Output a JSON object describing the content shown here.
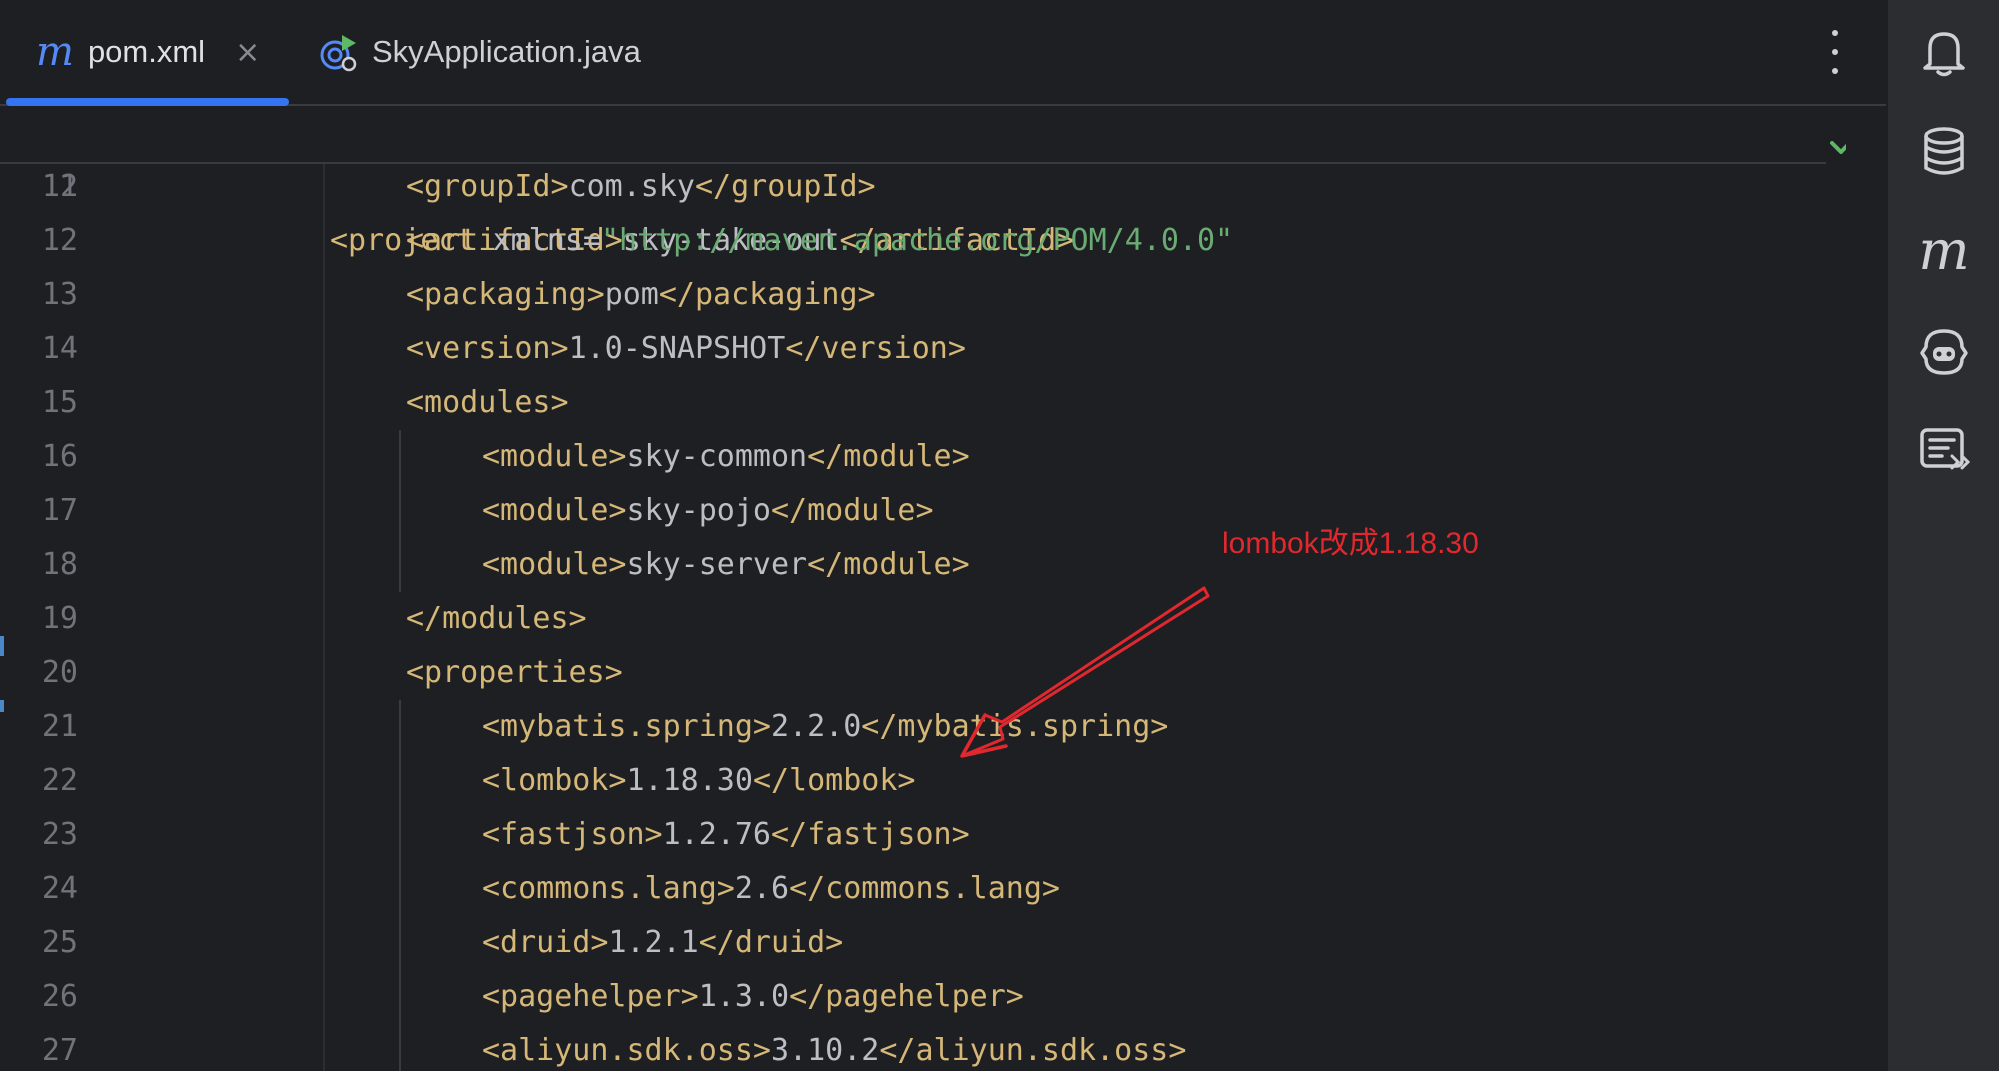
{
  "tabs": [
    {
      "label": "pom.xml",
      "icon": "maven-m-icon",
      "active": true,
      "close": "×"
    },
    {
      "label": "SkyApplication.java",
      "icon": "run-config-icon",
      "active": false
    }
  ],
  "sticky_line": {
    "number": "2",
    "tokens": [
      {
        "t": "tag",
        "v": "<project "
      },
      {
        "t": "attr",
        "v": "xmlns"
      },
      {
        "t": "plain",
        "v": "="
      },
      {
        "t": "val",
        "v": "\"http://maven.apache.org/POM/4.0.0\""
      }
    ]
  },
  "lines": [
    {
      "number": "11",
      "indent": 1,
      "tokens": [
        {
          "t": "tag",
          "v": "<groupId>"
        },
        {
          "t": "plain",
          "v": "com.sky"
        },
        {
          "t": "tag",
          "v": "</groupId>"
        }
      ]
    },
    {
      "number": "12",
      "indent": 1,
      "tokens": [
        {
          "t": "tag",
          "v": "<artifactId>"
        },
        {
          "t": "plain",
          "v": "sky-take-out"
        },
        {
          "t": "tag",
          "v": "</artifactId>"
        }
      ]
    },
    {
      "number": "13",
      "indent": 1,
      "tokens": [
        {
          "t": "tag",
          "v": "<packaging>"
        },
        {
          "t": "plain",
          "v": "pom"
        },
        {
          "t": "tag",
          "v": "</packaging>"
        }
      ]
    },
    {
      "number": "14",
      "indent": 1,
      "tokens": [
        {
          "t": "tag",
          "v": "<version>"
        },
        {
          "t": "plain",
          "v": "1.0-SNAPSHOT"
        },
        {
          "t": "tag",
          "v": "</version>"
        }
      ]
    },
    {
      "number": "15",
      "indent": 1,
      "tokens": [
        {
          "t": "tag",
          "v": "<modules>"
        }
      ]
    },
    {
      "number": "16",
      "indent": 2,
      "tokens": [
        {
          "t": "tag",
          "v": "<module>"
        },
        {
          "t": "plain",
          "v": "sky-common"
        },
        {
          "t": "tag",
          "v": "</module>"
        }
      ]
    },
    {
      "number": "17",
      "indent": 2,
      "tokens": [
        {
          "t": "tag",
          "v": "<module>"
        },
        {
          "t": "plain",
          "v": "sky-pojo"
        },
        {
          "t": "tag",
          "v": "</module>"
        }
      ]
    },
    {
      "number": "18",
      "indent": 2,
      "tokens": [
        {
          "t": "tag",
          "v": "<module>"
        },
        {
          "t": "plain",
          "v": "sky-server"
        },
        {
          "t": "tag",
          "v": "</module>"
        }
      ]
    },
    {
      "number": "19",
      "indent": 1,
      "tokens": [
        {
          "t": "tag",
          "v": "</modules>"
        }
      ]
    },
    {
      "number": "20",
      "indent": 1,
      "tokens": [
        {
          "t": "tag",
          "v": "<properties>"
        }
      ]
    },
    {
      "number": "21",
      "indent": 2,
      "tokens": [
        {
          "t": "tag",
          "v": "<mybatis.spring>"
        },
        {
          "t": "plain",
          "v": "2.2.0"
        },
        {
          "t": "tag",
          "v": "</mybatis.spring>"
        }
      ]
    },
    {
      "number": "22",
      "indent": 2,
      "tokens": [
        {
          "t": "tag",
          "v": "<lombok>"
        },
        {
          "t": "plain",
          "v": "1.18.30"
        },
        {
          "t": "tag",
          "v": "</lombok>"
        }
      ]
    },
    {
      "number": "23",
      "indent": 2,
      "tokens": [
        {
          "t": "tag",
          "v": "<fastjson>"
        },
        {
          "t": "plain",
          "v": "1.2.76"
        },
        {
          "t": "tag",
          "v": "</fastjson>"
        }
      ]
    },
    {
      "number": "24",
      "indent": 2,
      "tokens": [
        {
          "t": "tag",
          "v": "<commons.lang>"
        },
        {
          "t": "plain",
          "v": "2.6"
        },
        {
          "t": "tag",
          "v": "</commons.lang>"
        }
      ]
    },
    {
      "number": "25",
      "indent": 2,
      "tokens": [
        {
          "t": "tag",
          "v": "<druid>"
        },
        {
          "t": "plain",
          "v": "1.2.1"
        },
        {
          "t": "tag",
          "v": "</druid>"
        }
      ]
    },
    {
      "number": "26",
      "indent": 2,
      "tokens": [
        {
          "t": "tag",
          "v": "<pagehelper>"
        },
        {
          "t": "plain",
          "v": "1.3.0"
        },
        {
          "t": "tag",
          "v": "</pagehelper>"
        }
      ]
    },
    {
      "number": "27",
      "indent": 2,
      "tokens": [
        {
          "t": "tag",
          "v": "<aliyun.sdk.oss>"
        },
        {
          "t": "plain",
          "v": "3.10.2"
        },
        {
          "t": "tag",
          "v": "</aliyun.sdk.oss>"
        }
      ]
    }
  ],
  "annotation": {
    "text": "lombok改成1.18.30"
  },
  "right_toolbar": [
    {
      "icon": "notifications-bell-icon"
    },
    {
      "icon": "database-icon"
    },
    {
      "icon": "maven-icon",
      "glyph": "m"
    },
    {
      "icon": "ai-assistant-icon"
    },
    {
      "icon": "endpoints-icon"
    }
  ],
  "colors": {
    "background": "#1e1f22",
    "tag": "#d5b778",
    "value": "#6aab73",
    "plain": "#bcbec4",
    "accent": "#3574f0",
    "annotation": "#e0282e"
  }
}
